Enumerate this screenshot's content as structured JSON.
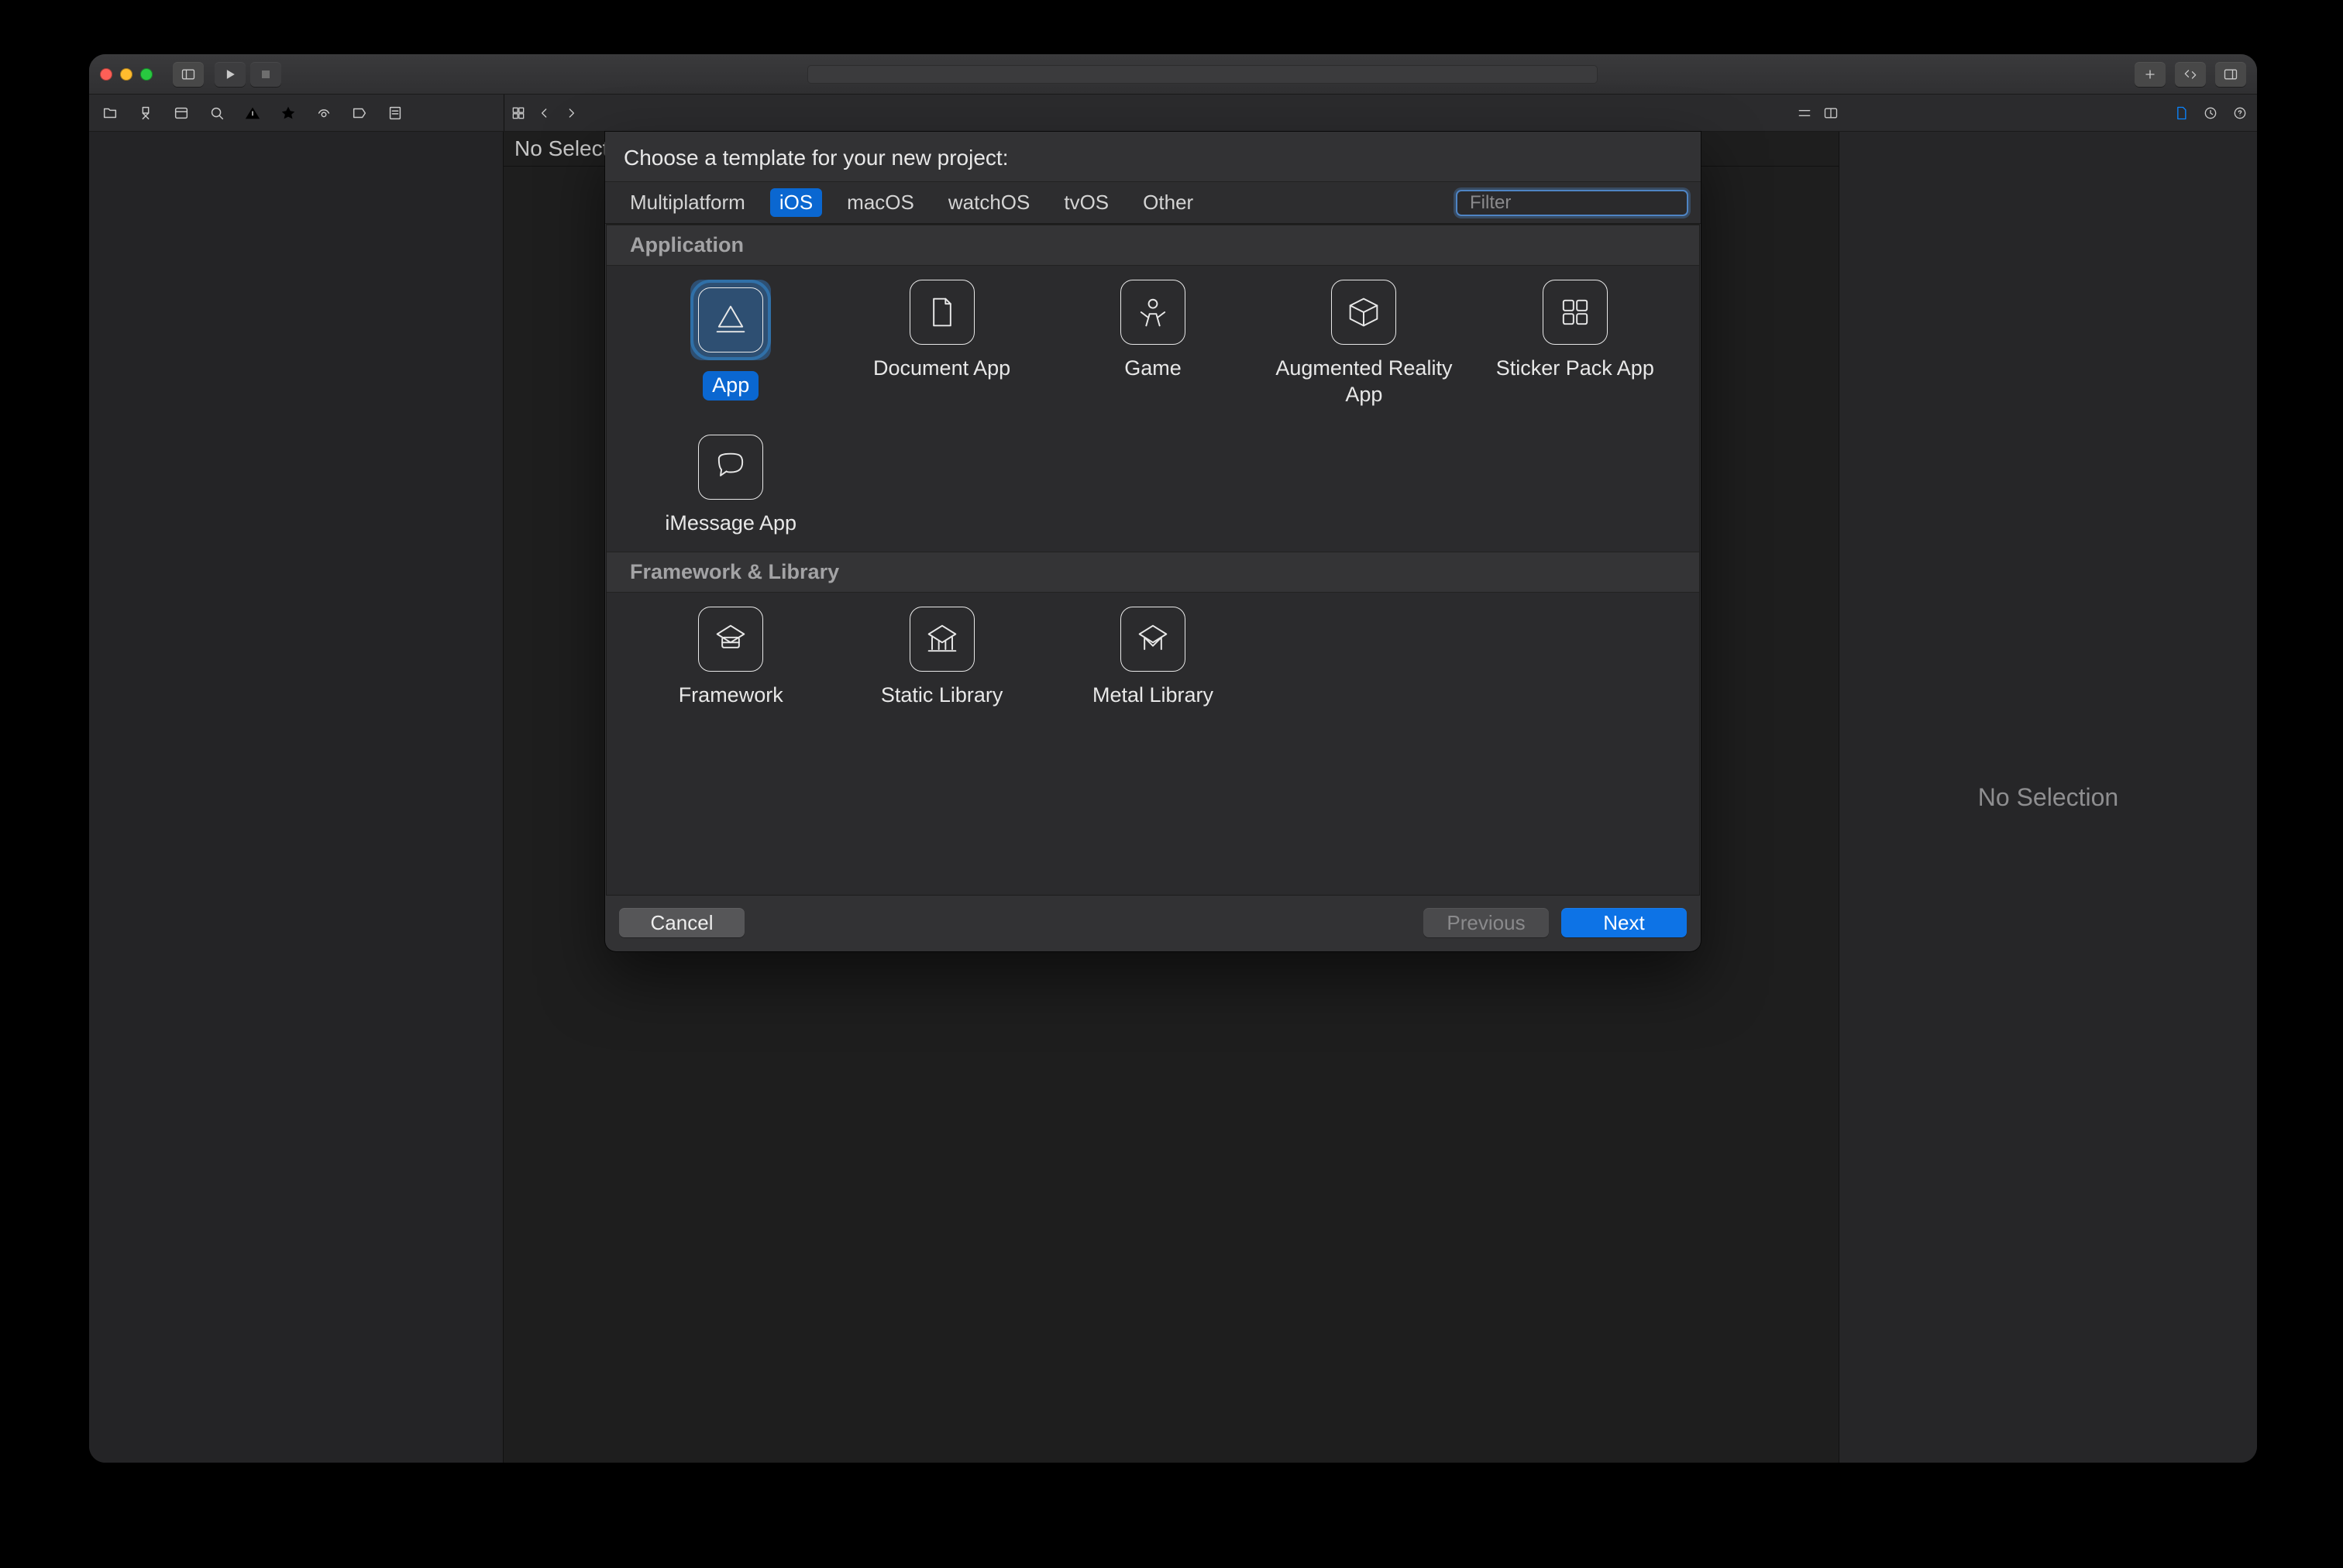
{
  "window": {
    "no_selection_center": "No Selection",
    "no_selection_right": "No Selection"
  },
  "sheet": {
    "title": "Choose a template for your new project:",
    "tabs": [
      "Multiplatform",
      "iOS",
      "macOS",
      "watchOS",
      "tvOS",
      "Other"
    ],
    "active_tab_index": 1,
    "filter_placeholder": "Filter",
    "sections": [
      {
        "title": "Application",
        "templates": [
          {
            "name": "App",
            "selected": true,
            "icon": "app-store-icon"
          },
          {
            "name": "Document App",
            "icon": "document-icon"
          },
          {
            "name": "Game",
            "icon": "game-icon"
          },
          {
            "name": "Augmented Reality App",
            "icon": "ar-cube-icon"
          },
          {
            "name": "Sticker Pack App",
            "icon": "grid-4-icon"
          },
          {
            "name": "iMessage App",
            "icon": "chat-bubble-icon"
          }
        ]
      },
      {
        "title": "Framework & Library",
        "templates": [
          {
            "name": "Framework",
            "icon": "toolbox-icon"
          },
          {
            "name": "Static Library",
            "icon": "library-icon"
          },
          {
            "name": "Metal Library",
            "icon": "metal-m-icon"
          }
        ]
      }
    ],
    "buttons": {
      "cancel": "Cancel",
      "previous": "Previous",
      "next": "Next"
    }
  }
}
